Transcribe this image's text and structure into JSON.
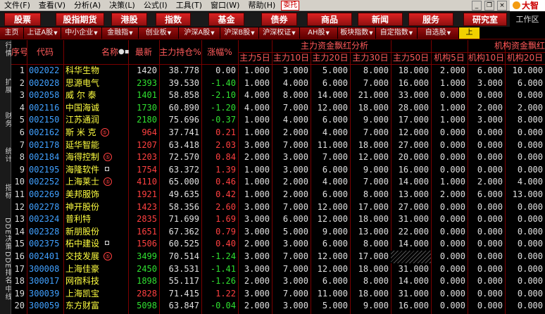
{
  "menu": {
    "items": [
      "文件(F)",
      "查看(V)",
      "分析(A)",
      "决策(L)",
      "公式(I)",
      "工具(T)",
      "窗口(W)",
      "帮助(H)"
    ],
    "entrust": "委托",
    "brand": "大智"
  },
  "topnav": {
    "buttons": [
      "股票",
      "股指期货",
      "港股",
      "指数",
      "基金",
      "债券",
      "商品",
      "新闻",
      "服务",
      "研究室"
    ],
    "workzone": "工作区"
  },
  "tabs": [
    {
      "label": "主页",
      "dropdown": false,
      "active": false
    },
    {
      "label": "上证A股",
      "dropdown": true,
      "active": false
    },
    {
      "label": "中小企业",
      "dropdown": true,
      "active": false
    },
    {
      "label": "金融指",
      "dropdown": true,
      "active": false
    },
    {
      "label": "创业板",
      "dropdown": true,
      "active": false
    },
    {
      "label": "沪深A股",
      "dropdown": true,
      "active": false
    },
    {
      "label": "沪深B股",
      "dropdown": true,
      "active": false
    },
    {
      "label": "沪深权证",
      "dropdown": true,
      "active": false
    },
    {
      "label": "AH股",
      "dropdown": true,
      "active": false
    },
    {
      "label": "板块指数",
      "dropdown": true,
      "active": false
    },
    {
      "label": "自定指数",
      "dropdown": true,
      "active": false
    },
    {
      "label": "自选股",
      "dropdown": true,
      "active": false
    },
    {
      "label": "上",
      "dropdown": false,
      "active": true
    }
  ],
  "sidebar": [
    "行情",
    "扩展",
    "财务",
    "统计",
    "指标",
    "DDE决策",
    "DDE排名",
    "中线"
  ],
  "table": {
    "headers": {
      "seq": "序号",
      "code": "代码",
      "name": "名称",
      "latest": "最新",
      "main_pct": "主力持仓%",
      "change": "涨幅%",
      "group1": "主力资金飘红分析",
      "group2": "机构资金飘红",
      "sub": [
        "主力5日",
        "主力10日",
        "主力20日",
        "主力30日",
        "主力50日",
        "机构5日",
        "机构10日",
        "机构20日"
      ]
    },
    "colors": {
      "up": "#ff4040",
      "down": "#30e030",
      "name": "#ffff40",
      "code": "#40a0ff",
      "header": "#ff5a5a",
      "grid": "#7a0000"
    },
    "rows": [
      {
        "seq": "1",
        "code": "002022",
        "name": "科华生物",
        "badge": "",
        "mark": false,
        "latest": "1420",
        "latest_dir": "white",
        "main": "38.778",
        "chg": "0.00",
        "chg_dir": "white",
        "m5": "1.000",
        "m10": "3.000",
        "m20": "5.000",
        "m30": "8.000",
        "m50": "18.000",
        "i5": "2.000",
        "i10": "6.000",
        "i20": "10.000"
      },
      {
        "seq": "2",
        "code": "002028",
        "name": "思源电气",
        "badge": "",
        "mark": false,
        "latest": "2393",
        "latest_dir": "down",
        "main": "39.530",
        "chg": "-1.40",
        "chg_dir": "down",
        "m5": "1.000",
        "m10": "4.000",
        "m20": "6.000",
        "m30": "7.000",
        "m50": "16.000",
        "i5": "1.000",
        "i10": "3.000",
        "i20": "6.000"
      },
      {
        "seq": "3",
        "code": "002058",
        "name": "威 尔 泰",
        "badge": "",
        "mark": false,
        "latest": "1401",
        "latest_dir": "down",
        "main": "58.858",
        "chg": "-2.10",
        "chg_dir": "down",
        "m5": "4.000",
        "m10": "8.000",
        "m20": "14.000",
        "m30": "21.000",
        "m50": "33.000",
        "i5": "0.000",
        "i10": "0.000",
        "i20": "0.000"
      },
      {
        "seq": "4",
        "code": "002116",
        "name": "中国海诚",
        "badge": "",
        "mark": false,
        "latest": "1730",
        "latest_dir": "down",
        "main": "60.890",
        "chg": "-1.20",
        "chg_dir": "down",
        "m5": "4.000",
        "m10": "7.000",
        "m20": "12.000",
        "m30": "18.000",
        "m50": "28.000",
        "i5": "1.000",
        "i10": "2.000",
        "i20": "2.000"
      },
      {
        "seq": "5",
        "code": "002150",
        "name": "江苏通润",
        "badge": "",
        "mark": false,
        "latest": "2180",
        "latest_dir": "down",
        "main": "75.696",
        "chg": "-0.37",
        "chg_dir": "down",
        "m5": "1.000",
        "m10": "4.000",
        "m20": "6.000",
        "m30": "9.000",
        "m50": "17.000",
        "i5": "1.000",
        "i10": "3.000",
        "i20": "8.000"
      },
      {
        "seq": "6",
        "code": "002162",
        "name": "斯 米 克",
        "badge": "⑤",
        "mark": false,
        "latest": "964",
        "latest_dir": "up",
        "main": "37.741",
        "chg": "0.21",
        "chg_dir": "up",
        "m5": "1.000",
        "m10": "2.000",
        "m20": "4.000",
        "m30": "7.000",
        "m50": "12.000",
        "i5": "0.000",
        "i10": "0.000",
        "i20": "0.000"
      },
      {
        "seq": "7",
        "code": "002178",
        "name": "延华智能",
        "badge": "",
        "mark": false,
        "latest": "1207",
        "latest_dir": "up",
        "main": "63.418",
        "chg": "2.03",
        "chg_dir": "up",
        "m5": "3.000",
        "m10": "7.000",
        "m20": "11.000",
        "m30": "18.000",
        "m50": "27.000",
        "i5": "0.000",
        "i10": "0.000",
        "i20": "0.000"
      },
      {
        "seq": "8",
        "code": "002184",
        "name": "海得控制",
        "badge": "⑤",
        "mark": false,
        "latest": "1203",
        "latest_dir": "up",
        "main": "72.570",
        "chg": "0.84",
        "chg_dir": "up",
        "m5": "2.000",
        "m10": "3.000",
        "m20": "7.000",
        "m30": "12.000",
        "m50": "20.000",
        "i5": "0.000",
        "i10": "0.000",
        "i20": "0.000"
      },
      {
        "seq": "9",
        "code": "002195",
        "name": "海隆软件",
        "badge": "",
        "mark": true,
        "latest": "1754",
        "latest_dir": "up",
        "main": "63.372",
        "chg": "1.39",
        "chg_dir": "up",
        "m5": "1.000",
        "m10": "3.000",
        "m20": "6.000",
        "m30": "9.000",
        "m50": "16.000",
        "i5": "0.000",
        "i10": "0.000",
        "i20": "0.000"
      },
      {
        "seq": "10",
        "code": "002252",
        "name": "上海莱士",
        "badge": "⑤",
        "mark": false,
        "latest": "4110",
        "latest_dir": "up",
        "main": "65.000",
        "chg": "0.46",
        "chg_dir": "up",
        "m5": "1.000",
        "m10": "2.000",
        "m20": "4.000",
        "m30": "7.000",
        "m50": "14.000",
        "i5": "1.000",
        "i10": "2.000",
        "i20": "4.000"
      },
      {
        "seq": "11",
        "code": "002269",
        "name": "美邦服饰",
        "badge": "",
        "mark": false,
        "latest": "1921",
        "latest_dir": "up",
        "main": "49.635",
        "chg": "0.42",
        "chg_dir": "up",
        "m5": "1.000",
        "m10": "2.000",
        "m20": "6.000",
        "m30": "8.000",
        "m50": "13.000",
        "i5": "2.000",
        "i10": "6.000",
        "i20": "13.000"
      },
      {
        "seq": "12",
        "code": "002278",
        "name": "神开股份",
        "badge": "",
        "mark": false,
        "latest": "1423",
        "latest_dir": "up",
        "main": "58.356",
        "chg": "2.60",
        "chg_dir": "up",
        "m5": "3.000",
        "m10": "7.000",
        "m20": "12.000",
        "m30": "17.000",
        "m50": "27.000",
        "i5": "0.000",
        "i10": "0.000",
        "i20": "0.000"
      },
      {
        "seq": "13",
        "code": "002324",
        "name": "普利特",
        "badge": "",
        "mark": false,
        "latest": "2835",
        "latest_dir": "up",
        "main": "71.699",
        "chg": "1.69",
        "chg_dir": "up",
        "m5": "3.000",
        "m10": "6.000",
        "m20": "12.000",
        "m30": "18.000",
        "m50": "31.000",
        "i5": "0.000",
        "i10": "0.000",
        "i20": "0.000"
      },
      {
        "seq": "14",
        "code": "002328",
        "name": "新朋股份",
        "badge": "",
        "mark": false,
        "latest": "1651",
        "latest_dir": "up",
        "main": "67.362",
        "chg": "0.79",
        "chg_dir": "up",
        "m5": "3.000",
        "m10": "5.000",
        "m20": "9.000",
        "m30": "13.000",
        "m50": "22.000",
        "i5": "0.000",
        "i10": "0.000",
        "i20": "0.000"
      },
      {
        "seq": "15",
        "code": "002375",
        "name": "柘中建设",
        "badge": "",
        "mark": true,
        "latest": "1506",
        "latest_dir": "up",
        "main": "60.525",
        "chg": "0.40",
        "chg_dir": "up",
        "m5": "2.000",
        "m10": "3.000",
        "m20": "6.000",
        "m30": "8.000",
        "m50": "14.000",
        "i5": "0.000",
        "i10": "0.000",
        "i20": "0.000"
      },
      {
        "seq": "16",
        "code": "002401",
        "name": "交技发展",
        "badge": "⑤",
        "mark": false,
        "latest": "3499",
        "latest_dir": "down",
        "main": "70.514",
        "chg": "-1.24",
        "chg_dir": "down",
        "m5": "3.000",
        "m10": "7.000",
        "m20": "12.000",
        "m30": "17.000",
        "m50": "",
        "i5": "0.000",
        "i10": "0.000",
        "i20": "0.000"
      },
      {
        "seq": "17",
        "code": "300008",
        "name": "上海佳豪",
        "badge": "",
        "mark": false,
        "latest": "2450",
        "latest_dir": "down",
        "main": "63.531",
        "chg": "-1.41",
        "chg_dir": "down",
        "m5": "3.000",
        "m10": "7.000",
        "m20": "12.000",
        "m30": "18.000",
        "m50": "31.000",
        "i5": "0.000",
        "i10": "0.000",
        "i20": "0.000"
      },
      {
        "seq": "18",
        "code": "300017",
        "name": "网宿科技",
        "badge": "",
        "mark": false,
        "latest": "1898",
        "latest_dir": "down",
        "main": "55.117",
        "chg": "-1.26",
        "chg_dir": "down",
        "m5": "2.000",
        "m10": "3.000",
        "m20": "6.000",
        "m30": "8.000",
        "m50": "14.000",
        "i5": "0.000",
        "i10": "0.000",
        "i20": "0.000"
      },
      {
        "seq": "19",
        "code": "300039",
        "name": "上海凯宝",
        "badge": "",
        "mark": false,
        "latest": "2828",
        "latest_dir": "up",
        "main": "71.415",
        "chg": "1.22",
        "chg_dir": "up",
        "m5": "3.000",
        "m10": "7.000",
        "m20": "11.000",
        "m30": "18.000",
        "m50": "31.000",
        "i5": "0.000",
        "i10": "0.000",
        "i20": "0.000"
      },
      {
        "seq": "20",
        "code": "300059",
        "name": "东方财富",
        "badge": "",
        "mark": false,
        "latest": "5098",
        "latest_dir": "down",
        "main": "63.847",
        "chg": "-0.04",
        "chg_dir": "down",
        "m5": "2.000",
        "m10": "3.000",
        "m20": "5.000",
        "m30": "9.000",
        "m50": "16.000",
        "i5": "0.000",
        "i10": "0.000",
        "i20": "0.000"
      }
    ]
  }
}
